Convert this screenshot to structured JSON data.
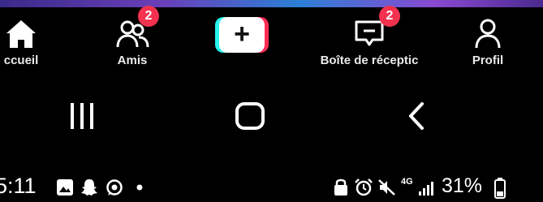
{
  "tabs": {
    "home": {
      "label": "ccueil",
      "icon": "home-icon"
    },
    "friends": {
      "label": "Amis",
      "icon": "friends-icon",
      "badge": "2"
    },
    "create": {
      "symbol": "+",
      "icon": "plus-icon"
    },
    "inbox": {
      "label": "Boîte de réceptic",
      "icon": "inbox-icon",
      "badge": "2"
    },
    "profile": {
      "label": "Profil",
      "icon": "person-icon"
    }
  },
  "system_nav": {
    "recents": "recents-icon",
    "home": "home-button-icon",
    "back": "back-icon"
  },
  "status_bar": {
    "time": "5:11",
    "left_icons": [
      "gallery-icon",
      "snapchat-icon",
      "whatsapp-icon",
      "dot-icon"
    ],
    "right_icons": [
      "lock-icon",
      "alarm-icon",
      "mute-icon",
      "4g-icon",
      "signal-icon"
    ],
    "network": "4G",
    "battery": "31%"
  },
  "colors": {
    "accent_red": "#f2324f",
    "cyan": "#25f4ee",
    "pink": "#fe2c55"
  }
}
